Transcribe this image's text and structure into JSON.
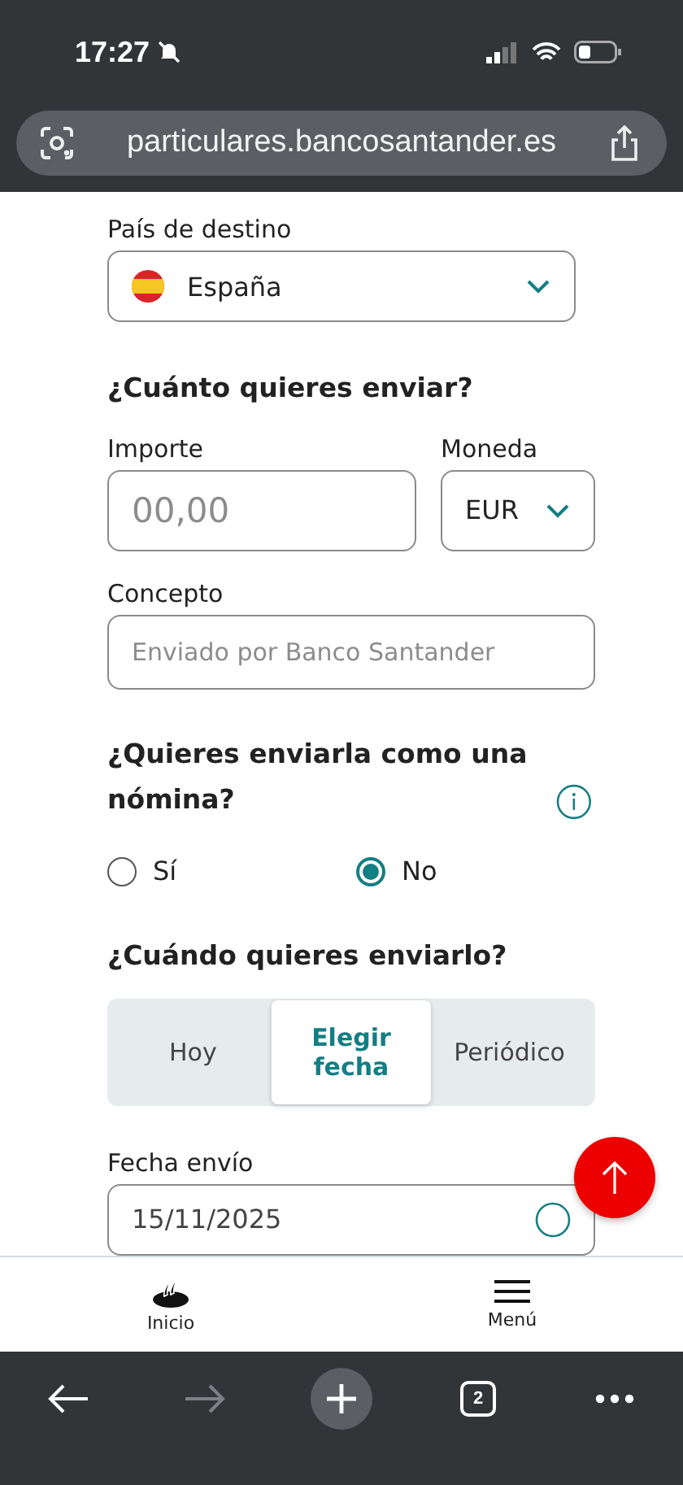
{
  "status_bar": {
    "time": "17:27"
  },
  "browser": {
    "url": "particulares.bancosantander.es",
    "tab_count": "2",
    "forward_disabled": true
  },
  "form": {
    "country": {
      "label": "País de destino",
      "value": "España"
    },
    "amount_heading": "¿Cuánto quieres enviar?",
    "amount": {
      "label": "Importe",
      "placeholder": "00,00"
    },
    "currency": {
      "label": "Moneda",
      "value": "EUR"
    },
    "concept": {
      "label": "Concepto",
      "placeholder": "Enviado por Banco Santander"
    },
    "payroll_heading": "¿Quieres enviarla como una nómina?",
    "payroll_options": [
      {
        "label": "Sí",
        "selected": false
      },
      {
        "label": "No",
        "selected": true
      }
    ],
    "when_heading": "¿Cuándo quieres enviarlo?",
    "when_tabs": [
      {
        "label": "Hoy",
        "selected": false
      },
      {
        "label": "Elegir fecha",
        "selected": true
      },
      {
        "label": "Periódico",
        "selected": false
      }
    ],
    "date": {
      "label": "Fecha envío",
      "value": "15/11/2025"
    }
  },
  "bottom_nav": [
    {
      "kind": "home",
      "label": "Inicio"
    },
    {
      "kind": "menu",
      "label": "Menú"
    }
  ]
}
